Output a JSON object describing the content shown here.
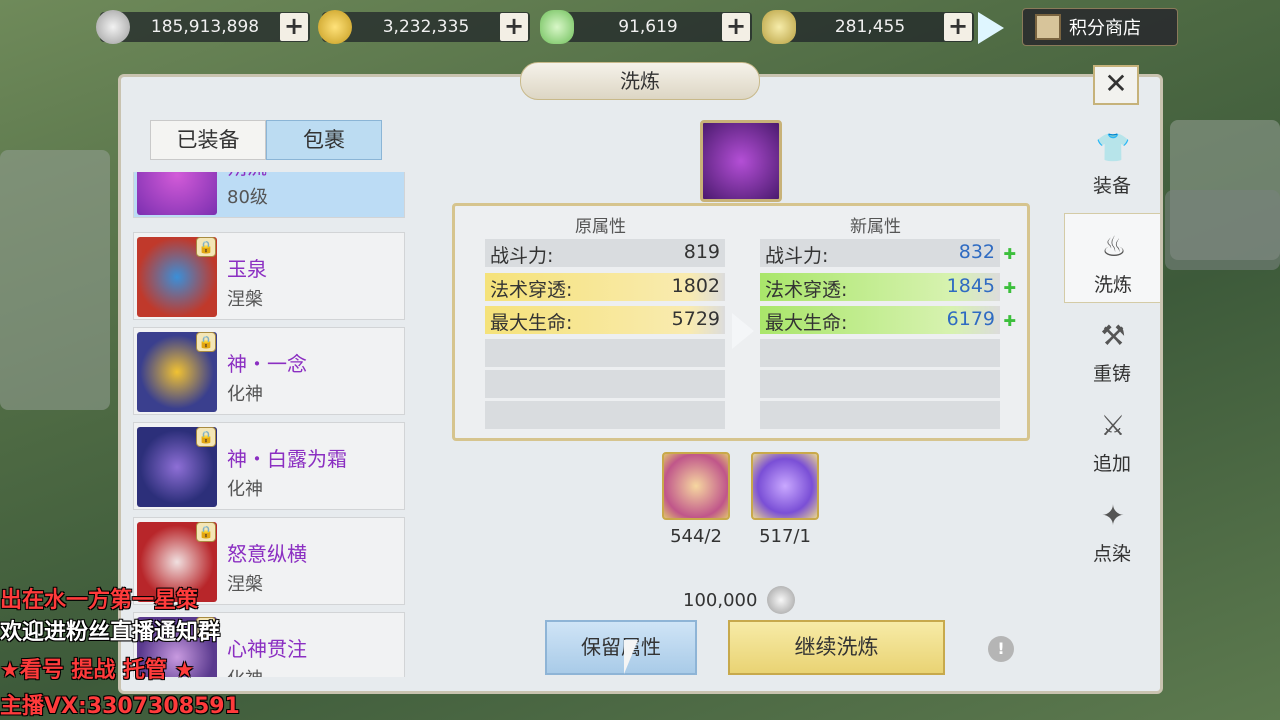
{
  "currencies": [
    {
      "value": "185,913,898",
      "icon": "silver-coin-icon",
      "color": "#c8c8c8"
    },
    {
      "value": "3,232,335",
      "icon": "gold-coin-icon",
      "color": "#e3b93a"
    },
    {
      "value": "91,619",
      "icon": "jade-ingot-icon",
      "color": "#9fe08a"
    },
    {
      "value": "281,455",
      "icon": "gold-ingot-icon",
      "color": "#d6c05a"
    }
  ],
  "plus_label": "+",
  "shop_label": "积分商店",
  "title": "洗炼",
  "close_label": "✕",
  "tabs": [
    {
      "label": "已装备"
    },
    {
      "label": "包裹"
    }
  ],
  "items": [
    {
      "name": "朔流",
      "sub": "80级",
      "colors": [
        "#7b2fb0",
        "#d25bd8"
      ]
    },
    {
      "name": "玉泉",
      "sub": "涅槃",
      "colors": [
        "#c0392b",
        "#5b2a7a"
      ]
    },
    {
      "name": "神・一念",
      "sub": "化神",
      "colors": [
        "#3a3f8e",
        "#f1c232"
      ]
    },
    {
      "name": "神・白露为霜",
      "sub": "化神",
      "colors": [
        "#2c2f7a",
        "#8e6fd6"
      ]
    },
    {
      "name": "怒意纵横",
      "sub": "涅槃",
      "colors": [
        "#b8262a",
        "#f0e0e0"
      ]
    },
    {
      "name": "心神贯注",
      "sub": "化神",
      "colors": [
        "#5a3a8e",
        "#c89ae0"
      ]
    }
  ],
  "attributes": {
    "old_header": "原属性",
    "new_header": "新属性",
    "old": [
      {
        "label": "战斗力:",
        "value": "819"
      },
      {
        "label": "法术穿透:",
        "value": "1802"
      },
      {
        "label": "最大生命:",
        "value": "5729"
      }
    ],
    "new": [
      {
        "label": "战斗力:",
        "value": "832"
      },
      {
        "label": "法术穿透:",
        "value": "1845"
      },
      {
        "label": "最大生命:",
        "value": "6179"
      }
    ]
  },
  "materials": [
    {
      "count": "544/2",
      "icon": "refine-scroll-icon"
    },
    {
      "count": "517/1",
      "icon": "purple-crystal-icon"
    }
  ],
  "cost": "100,000",
  "buttons": {
    "keep": "保留属性",
    "continue": "继续洗炼",
    "info": "!"
  },
  "sidenav": [
    {
      "label": "装备",
      "icon": "armor-icon",
      "glyph": "👕"
    },
    {
      "label": "洗炼",
      "icon": "cauldron-icon",
      "glyph": "♨"
    },
    {
      "label": "重铸",
      "icon": "anvil-icon",
      "glyph": "⚒"
    },
    {
      "label": "追加",
      "icon": "sword-icon",
      "glyph": "⚔"
    },
    {
      "label": "点染",
      "icon": "flame-icon",
      "glyph": "✦"
    }
  ],
  "overlay": [
    {
      "text": "出在水一方第一星策",
      "color": "#ff3b3b"
    },
    {
      "text": "欢迎进粉丝直播通知群",
      "color": "#ffffff"
    },
    {
      "text": "★看号 提战 托管 ★",
      "color": "#ff3b3b"
    },
    {
      "text": "主播VX:3307308591",
      "color": "#ff3b3b"
    }
  ]
}
